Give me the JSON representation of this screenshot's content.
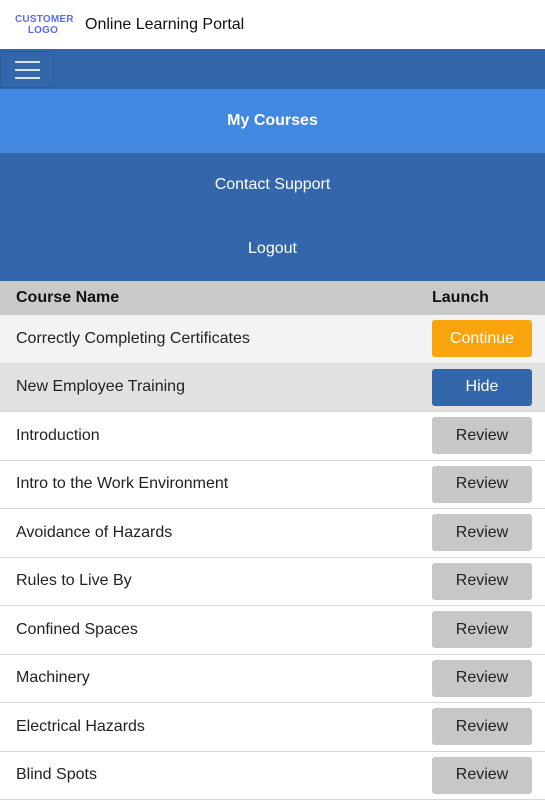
{
  "header": {
    "logo_line1": "CUSTOMER",
    "logo_line2": "LOGO",
    "title": "Online Learning Portal"
  },
  "menu": {
    "items": [
      {
        "label": "My Courses",
        "active": true
      },
      {
        "label": "Contact Support",
        "active": false
      },
      {
        "label": "Logout",
        "active": false
      }
    ]
  },
  "table": {
    "headers": {
      "name": "Course Name",
      "launch": "Launch"
    },
    "rows": [
      {
        "name": "Correctly Completing Certificates",
        "action": "Continue"
      },
      {
        "name": "New Employee Training",
        "action": "Hide"
      },
      {
        "name": "Introduction",
        "action": "Review"
      },
      {
        "name": "Intro to the Work Environment",
        "action": "Review"
      },
      {
        "name": "Avoidance of Hazards",
        "action": "Review"
      },
      {
        "name": "Rules to Live By",
        "action": "Review"
      },
      {
        "name": "Confined Spaces",
        "action": "Review"
      },
      {
        "name": "Machinery",
        "action": "Review"
      },
      {
        "name": "Electrical Hazards",
        "action": "Review"
      },
      {
        "name": "Blind Spots",
        "action": "Review"
      }
    ]
  },
  "colors": {
    "navbar": "#3466ac",
    "active_menu": "#4388e0",
    "continue_button": "#f9a40c",
    "hide_button": "#3466ac",
    "review_button": "#c7c7c7",
    "logo": "#5a6cf0"
  },
  "icons": {
    "menu_toggle": "hamburger-menu-icon"
  }
}
